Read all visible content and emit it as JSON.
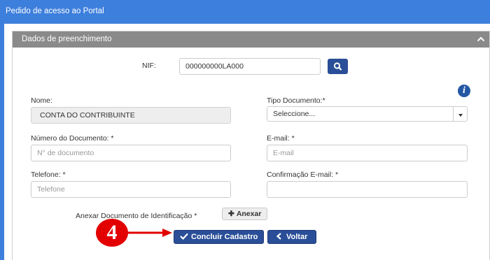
{
  "window": {
    "title": "Pedido de acesso ao Portal"
  },
  "section": {
    "title": "Dados de preenchimento"
  },
  "nif": {
    "label": "NIF:",
    "value": "000000000LA000"
  },
  "nome": {
    "label": "Nome:",
    "value": "CONTA DO CONTRIBUINTE"
  },
  "tipo_documento": {
    "label": "Tipo Documento:*",
    "selected": "Seleccione..."
  },
  "numero_documento": {
    "label": "Número do Documento: *",
    "placeholder": "N° de documento"
  },
  "email": {
    "label": "E-mail: *",
    "placeholder": "E-mail"
  },
  "telefone": {
    "label": "Telefone: *",
    "placeholder": "Telefone"
  },
  "confirmacao_email": {
    "label": "Confirmação E-mail: *",
    "placeholder": ""
  },
  "anexo": {
    "label": "Anexar Documento de Identificação *",
    "button_label": "Anexar"
  },
  "actions": {
    "concluir_label": "Concluir Cadastro",
    "voltar_label": "Voltar"
  },
  "annotation": {
    "step_number": "4"
  },
  "icons": {
    "search": "search-icon",
    "info": "info-icon",
    "collapse": "chevron-up-icon",
    "dropdown": "caret-down-icon",
    "plus": "plus-icon",
    "check": "check-icon",
    "back": "chevron-left-icon",
    "arrow": "arrow-right-icon"
  },
  "colors": {
    "header_blue": "#3d7fdc",
    "panel_header_gray": "#8a8a8a",
    "button_navy": "#2a4e97",
    "annotation_red": "#e20000"
  }
}
